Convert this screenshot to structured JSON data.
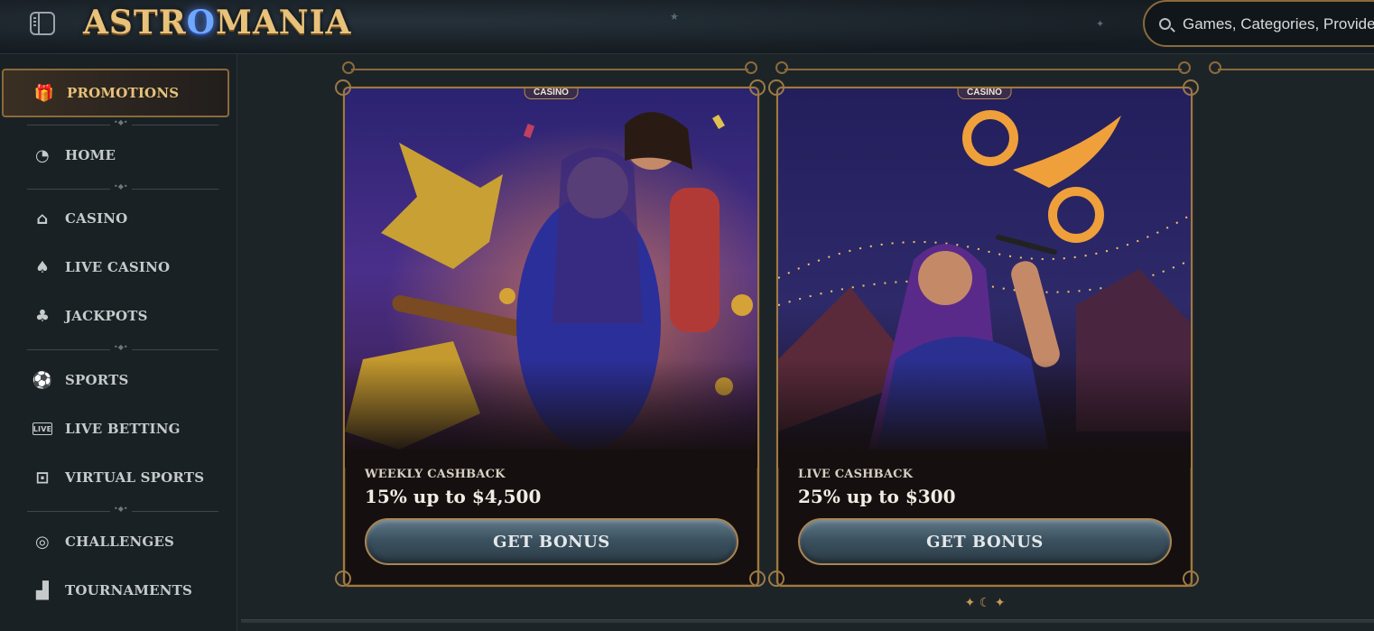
{
  "header": {
    "logo_text_before": "ASTR",
    "logo_orb": "O",
    "logo_text_after": "MANIA",
    "search_placeholder": "Games, Categories, Providers",
    "icons": {
      "sidebar_toggle": "sidebar-toggle-icon",
      "search": "search-icon"
    }
  },
  "sidebar": {
    "items": [
      {
        "label": "PROMOTIONS",
        "icon": "gift-icon",
        "glyph": "🎁",
        "active": true
      },
      {
        "label": "HOME",
        "icon": "home-icon",
        "glyph": "◔"
      },
      {
        "label": "CASINO",
        "icon": "slot-machine-icon",
        "glyph": "⌂"
      },
      {
        "label": "LIVE CASINO",
        "icon": "playing-card-icon",
        "glyph": "♠"
      },
      {
        "label": "JACKPOTS",
        "icon": "clover-icon",
        "glyph": "♣"
      },
      {
        "label": "SPORTS",
        "icon": "soccer-ball-icon",
        "glyph": "⚽"
      },
      {
        "label": "LIVE BETTING",
        "icon": "live-icon",
        "glyph": "LIVE"
      },
      {
        "label": "VIRTUAL SPORTS",
        "icon": "virtual-sports-icon",
        "glyph": "⊡"
      },
      {
        "label": "CHALLENGES",
        "icon": "medal-icon",
        "glyph": "◎"
      },
      {
        "label": "TOURNAMENTS",
        "icon": "podium-icon",
        "glyph": "▟"
      }
    ]
  },
  "cards": [
    {
      "tag": "CASINO",
      "subtitle": "WEEKLY CASHBACK",
      "title": "15% up to $4,500",
      "button": "GET BONUS"
    },
    {
      "tag": "CASINO",
      "subtitle": "LIVE CASHBACK",
      "title": "25% up to $300",
      "button": "GET BONUS"
    }
  ],
  "colors": {
    "gold": "#e8c27a",
    "frame": "#9b7a45",
    "background": "#1d2428",
    "sidebar": "#1a2125"
  }
}
